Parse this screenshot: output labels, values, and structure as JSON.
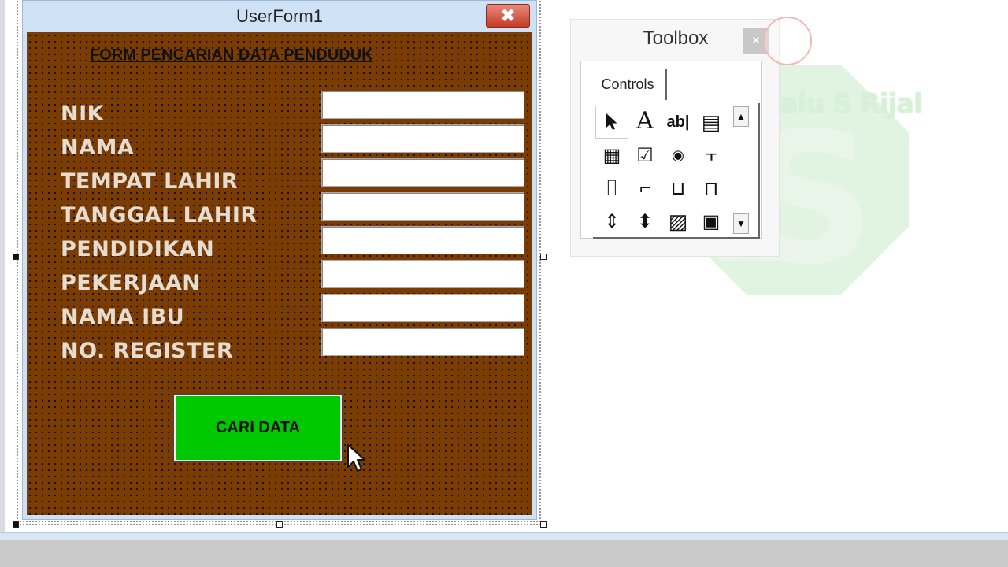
{
  "userform": {
    "title": "UserForm1",
    "close_glyph": "✖",
    "form_title": "FORM PENCARIAN DATA PENDUDUK",
    "fields": [
      {
        "label": "NIK"
      },
      {
        "label": "NAMA"
      },
      {
        "label": "TEMPAT LAHIR"
      },
      {
        "label": "TANGGAL LAHIR"
      },
      {
        "label": "PENDIDIKAN"
      },
      {
        "label": "PEKERJAAN"
      },
      {
        "label": "NAMA IBU"
      },
      {
        "label": "NO. REGISTER"
      }
    ],
    "search_button": "CARI DATA",
    "colors": {
      "form_bg": "#7a3c05",
      "button_bg": "#00c800",
      "label": "#e6dcd0"
    }
  },
  "toolbox": {
    "title": "Toolbox",
    "close_glyph": "×",
    "tab": "Controls",
    "tools": [
      {
        "name": "select-objects-icon",
        "glyph": "➤"
      },
      {
        "name": "label-tool-icon",
        "glyph": "A"
      },
      {
        "name": "textbox-tool-icon",
        "glyph": "ab|"
      },
      {
        "name": "combobox-tool-icon",
        "glyph": "▤"
      },
      {
        "name": "listbox-tool-icon",
        "glyph": "▦"
      },
      {
        "name": "checkbox-tool-icon",
        "glyph": "☑"
      },
      {
        "name": "optionbutton-tool-icon",
        "glyph": "◉"
      },
      {
        "name": "togglebutton-tool-icon",
        "glyph": "⫟"
      },
      {
        "name": "frame-tool-icon",
        "glyph": "⌷"
      },
      {
        "name": "commandbutton-tool-icon",
        "glyph": "⌐"
      },
      {
        "name": "tabstrip-tool-icon",
        "glyph": "⊔"
      },
      {
        "name": "multipage-tool-icon",
        "glyph": "⊓"
      },
      {
        "name": "scrollbar-tool-icon",
        "glyph": "⇕"
      },
      {
        "name": "spinbutton-tool-icon",
        "glyph": "⬍"
      },
      {
        "name": "image-tool-icon",
        "glyph": "▨"
      },
      {
        "name": "refedit-tool-icon",
        "glyph": "▣"
      }
    ]
  },
  "watermark": {
    "text": "Lalu S Rijal"
  }
}
